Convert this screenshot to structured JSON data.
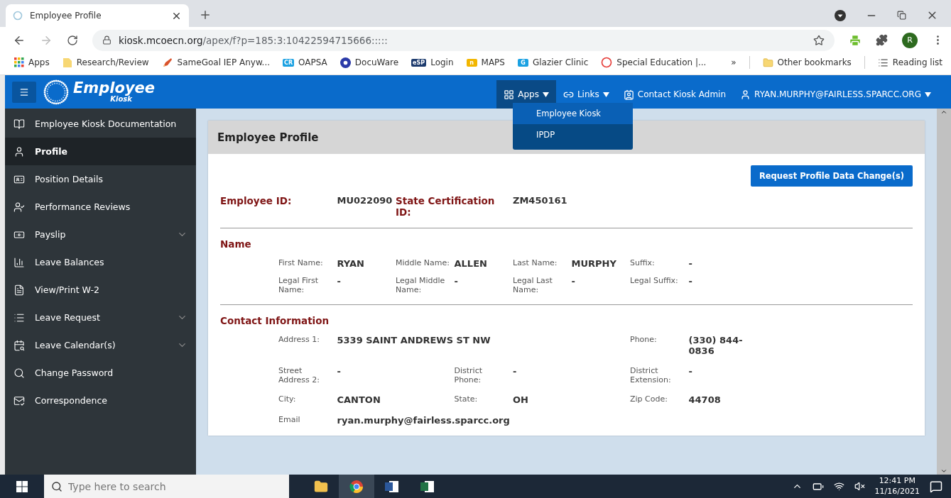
{
  "browser": {
    "tab_title": "Employee Profile",
    "url_host": "kiosk.mcoecn.org",
    "url_path": "/apex/f?p=185:3:10422594715666:::::",
    "profile_initial": "R",
    "bookmarks": [
      {
        "label": "Apps",
        "kind": "grid"
      },
      {
        "label": "Research/Review",
        "kind": "folder"
      },
      {
        "label": "SameGoal IEP Anyw...",
        "kind": "pencil"
      },
      {
        "label": "OAPSA",
        "kind": "badge",
        "badge": "CR",
        "color": "#1ba1e2"
      },
      {
        "label": "DocuWare",
        "kind": "circle",
        "color": "#2b3aa8"
      },
      {
        "label": "Login",
        "kind": "badge",
        "badge": "eSP",
        "color": "#1d3b6e"
      },
      {
        "label": "MAPS",
        "kind": "badge",
        "badge": "n",
        "color": "#f2b600"
      },
      {
        "label": "Glazier Clinic",
        "kind": "badge",
        "badge": "G",
        "color": "#1ba1e2"
      },
      {
        "label": "Special Education |...",
        "kind": "ring",
        "color": "#e53935"
      }
    ],
    "more": "»",
    "other_bookmarks": "Other bookmarks",
    "reading_list": "Reading list"
  },
  "app": {
    "logo_title": "Employee",
    "logo_subtitle": "Kiosk",
    "nav": [
      {
        "label": "Apps",
        "kind": "apps",
        "dropdown": true,
        "expanded": true
      },
      {
        "label": "Links",
        "kind": "links",
        "dropdown": true,
        "expanded": false
      },
      {
        "label": "Contact Kiosk Admin",
        "kind": "contact",
        "dropdown": false,
        "expanded": false
      },
      {
        "label": "RYAN.MURPHY@FAIRLESS.SPARCC.ORG",
        "kind": "user",
        "dropdown": true,
        "expanded": false
      }
    ],
    "apps_menu": [
      {
        "label": "Employee Kiosk",
        "selected": true
      },
      {
        "label": "IPDP",
        "selected": false
      }
    ]
  },
  "sidebar": {
    "items": [
      {
        "label": "Employee Kiosk Documentation",
        "selected": false,
        "has_submenu": false
      },
      {
        "label": "Profile",
        "selected": true,
        "has_submenu": false
      },
      {
        "label": "Position Details",
        "selected": false,
        "has_submenu": false
      },
      {
        "label": "Performance Reviews",
        "selected": false,
        "has_submenu": false
      },
      {
        "label": "Payslip",
        "selected": false,
        "has_submenu": true
      },
      {
        "label": "Leave Balances",
        "selected": false,
        "has_submenu": false
      },
      {
        "label": "View/Print W-2",
        "selected": false,
        "has_submenu": false
      },
      {
        "label": "Leave Request",
        "selected": false,
        "has_submenu": true
      },
      {
        "label": "Leave Calendar(s)",
        "selected": false,
        "has_submenu": true
      },
      {
        "label": "Change Password",
        "selected": false,
        "has_submenu": false
      },
      {
        "label": "Correspondence",
        "selected": false,
        "has_submenu": false
      }
    ]
  },
  "profile": {
    "title": "Employee Profile",
    "request_button": "Request Profile Data Change(s)",
    "ids": [
      {
        "label": "Employee ID:",
        "value": "MU022090"
      },
      {
        "label": "State Certification ID:",
        "value": "ZM450161"
      }
    ],
    "sections": [
      {
        "title": "Name",
        "rows": [
          [
            {
              "label": "First Name:",
              "value": "RYAN"
            },
            {
              "label": "Middle Name:",
              "value": "ALLEN"
            },
            {
              "label": "Last Name:",
              "value": "MURPHY"
            },
            {
              "label": "Suffix:",
              "value": "-"
            }
          ],
          [
            {
              "label": "Legal First Name:",
              "value": "-"
            },
            {
              "label": "Legal Middle Name:",
              "value": "-"
            },
            {
              "label": "Legal Last Name:",
              "value": "-"
            },
            {
              "label": "Legal Suffix:",
              "value": "-"
            }
          ]
        ]
      },
      {
        "title": "Contact Information",
        "rows": [
          [
            {
              "label": "Address 1:",
              "value": "5339 SAINT ANDREWS ST NW"
            },
            null,
            {
              "label": "Phone:",
              "value": "(330) 844-0836"
            }
          ],
          [
            {
              "label": "Street Address 2:",
              "value": "-"
            },
            {
              "label": "District Phone:",
              "value": "-"
            },
            {
              "label": "District Extension:",
              "value": "-"
            }
          ],
          [
            {
              "label": "City:",
              "value": "CANTON"
            },
            {
              "label": "State:",
              "value": "OH"
            },
            {
              "label": "Zip Code:",
              "value": "44708"
            }
          ],
          [
            {
              "label": "Email",
              "value": "ryan.murphy@fairless.sparcc.org"
            }
          ]
        ]
      }
    ]
  },
  "taskbar": {
    "search_placeholder": "Type here to search",
    "time": "12:41 PM",
    "date": "11/16/2021"
  }
}
